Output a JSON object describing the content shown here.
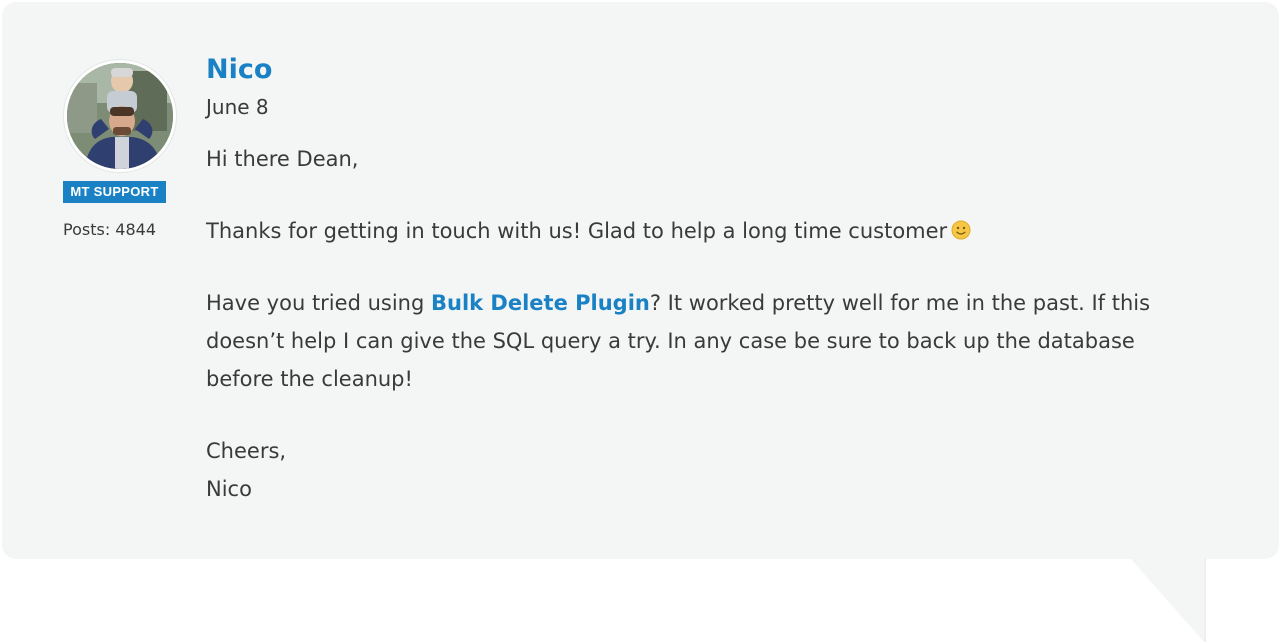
{
  "post": {
    "author": "Nico",
    "date": "June 8",
    "badge": "MT SUPPORT",
    "posts_count": "Posts: 4844",
    "avatar_icon": "user-photo-avatar",
    "greeting": "Hi there Dean,",
    "thanks": "Thanks for getting in touch with us! Glad to help a long time customer",
    "emoji_icon": "smiley-emoji-icon",
    "line1_before_link": "Have you tried using ",
    "link_text": "Bulk Delete Plugin",
    "line1_after_link": "? It worked pretty well for me in the past. If this",
    "line2": "doesn’t help I can give the SQL query a try. In any case be sure to back up the database",
    "line3": "before the cleanup!",
    "signoff": "Cheers,",
    "signature": "Nico"
  },
  "colors": {
    "accent": "#1a82c4",
    "bubble_bg": "#f4f5f5",
    "text": "#3a3a3a"
  }
}
